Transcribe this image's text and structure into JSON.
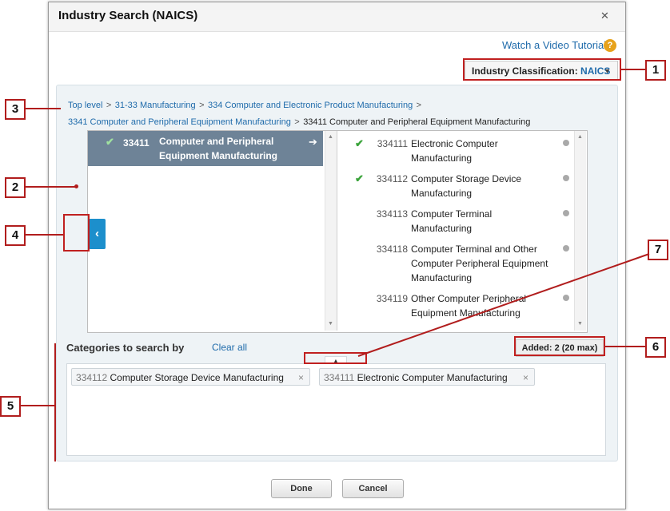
{
  "dialog": {
    "title": "Industry Search (NAICS)",
    "close_icon": "close-icon",
    "tutorial_link": "Watch a Video Tutorial",
    "help_icon": "?",
    "classification_label": "Industry Classification:",
    "classification_value": "NAICS",
    "caret_icon": "▼"
  },
  "breadcrumb": {
    "items": [
      "Top level",
      "31-33 Manufacturing",
      "334 Computer and Electronic Product Manufacturing",
      "3341 Computer and Peripheral Equipment Manufacturing"
    ],
    "separator": ">",
    "current": "33411 Computer and Peripheral Equipment Manufacturing"
  },
  "left_column": {
    "selected": {
      "code": "33411",
      "name_line1": "Computer and Peripheral",
      "name_line2": "Equipment Manufacturing",
      "arrow": "➔"
    }
  },
  "right_column": {
    "items": [
      {
        "code": "334111",
        "line1": "Electronic Computer",
        "line2": "Manufacturing",
        "line3": "",
        "checked": true
      },
      {
        "code": "334112",
        "line1": "Computer Storage Device",
        "line2": "Manufacturing",
        "line3": "",
        "checked": true
      },
      {
        "code": "334113",
        "line1": "Computer Terminal",
        "line2": "Manufacturing",
        "line3": "",
        "checked": false
      },
      {
        "code": "334118",
        "line1": "Computer Terminal and Other",
        "line2": "Computer Peripheral Equipment",
        "line3": "Manufacturing",
        "checked": false
      },
      {
        "code": "334119",
        "line1": "Other Computer Peripheral",
        "line2": "Equipment Manufacturing",
        "line3": "",
        "checked": false
      }
    ]
  },
  "back_button": "‹",
  "categories": {
    "title": "Categories to search by",
    "clear_all": "Clear all",
    "added": "Added: 2 (20 max)",
    "tags": [
      {
        "code": "334112",
        "label": "Computer Storage Device Manufacturing",
        "remove": "×"
      },
      {
        "code": "334111",
        "label": "Electronic Computer Manufacturing",
        "remove": "×"
      }
    ],
    "collapse_icon": "▲"
  },
  "footer": {
    "done": "Done",
    "cancel": "Cancel"
  },
  "callouts": {
    "c1": "1",
    "c2": "2",
    "c3": "3",
    "c4": "4",
    "c5": "5",
    "c6": "6",
    "c7": "7"
  },
  "colors": {
    "accent": "#1c8fcc",
    "link": "#1f6bab",
    "selected_row": "#6e8397",
    "annotation": "#b11d1d",
    "check": "#3aa33a"
  }
}
